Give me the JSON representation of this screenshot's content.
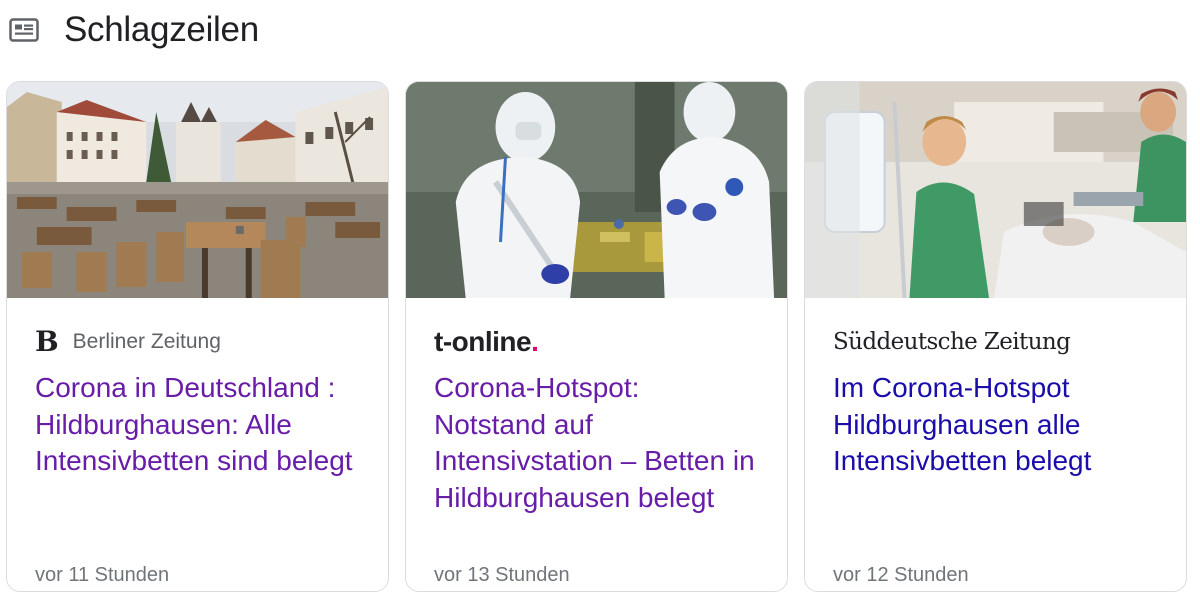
{
  "header": {
    "title": "Schlagzeilen",
    "icon": "newspaper-icon"
  },
  "colors": {
    "visited_link": "#681da8",
    "link": "#1a0dab",
    "meta_text": "#70757a",
    "tonline_dot": "#e20074"
  },
  "cards": [
    {
      "source": "Berliner Zeitung",
      "source_logo_glyph": "B",
      "headline": "Corona in Deutschland : Hildburghausen: Alle Intensivbetten sind belegt",
      "time": "vor 11 Stunden",
      "thumbnail": "town-square-empty-cafe"
    },
    {
      "source": "t-online",
      "source_logo_dot": ".",
      "headline": "Corona-Hotspot: Notstand auf Intensivstation – Betten in Hildburghausen belegt",
      "time": "vor 13 Stunden",
      "thumbnail": "workers-in-protective-suits"
    },
    {
      "source": "Süddeutsche Zeitung",
      "headline": "Im Corona-Hotspot Hildburghausen alle Intensivbetten belegt",
      "time": "vor 12 Stunden",
      "thumbnail": "hospital-intensive-care"
    }
  ]
}
